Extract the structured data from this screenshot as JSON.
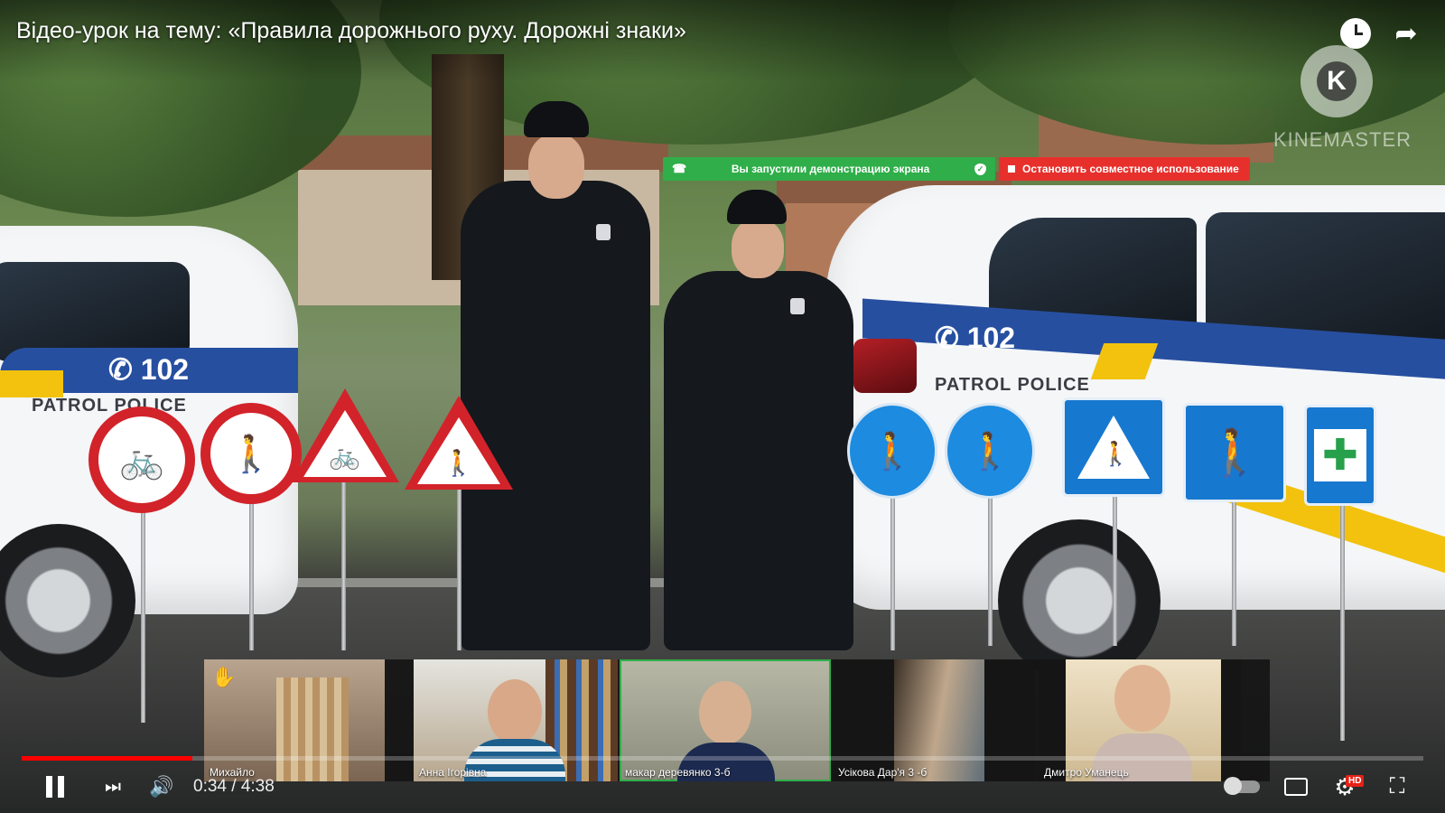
{
  "video": {
    "title": "Відео-урок на тему: «Правила дорожнього руху. Дорожні знаки»",
    "watermark": "KINEMASTER",
    "watermark_letter": "K"
  },
  "top_actions": {
    "watch_later_icon": "clock-icon",
    "share_icon": "share-icon",
    "share_glyph": "➦"
  },
  "screen_share": {
    "status_text": "Вы запустили демонстрацию экрана",
    "stop_text": "Остановить совместное использование",
    "pin_glyph": "☎",
    "shield_glyph": "✓",
    "status_color": "#2fae49",
    "stop_color": "#e7302c"
  },
  "scene": {
    "car_phone": "102",
    "car_text": "PATROL POLICE",
    "signs": [
      {
        "kind": "round-red",
        "glyph": "🚲"
      },
      {
        "kind": "round-red",
        "glyph": "🚶"
      },
      {
        "kind": "tri",
        "glyph": "🚲"
      },
      {
        "kind": "tri",
        "glyph": "🚶"
      },
      {
        "kind": "round-blue",
        "glyph": "🚶"
      },
      {
        "kind": "round-blue",
        "glyph": "🚶"
      },
      {
        "kind": "square-blue",
        "glyph": "🚶"
      },
      {
        "kind": "square-blue",
        "glyph": "🚶"
      },
      {
        "kind": "square-blue",
        "glyph": "✚"
      }
    ]
  },
  "participants": [
    {
      "name": "Михайло",
      "hand_raised": true,
      "active": false
    },
    {
      "name": "Анна Ігорівна",
      "hand_raised": false,
      "active": false
    },
    {
      "name": "макар  деревянко 3-б",
      "hand_raised": false,
      "active": true
    },
    {
      "name": "Усікова Дар'я 3 -б",
      "hand_raised": false,
      "active": false
    },
    {
      "name": "Дмитро Уманець",
      "hand_raised": false,
      "active": false
    }
  ],
  "player": {
    "time_display": "0:34 / 4:38",
    "progress_fraction": 0.122,
    "hd_label": "HD",
    "next_glyph": "⏭",
    "volume_glyph": "🔊",
    "settings_glyph": "⚙",
    "fullscreen_exit_glyph": "⛶",
    "progress_color": "#ff0000"
  }
}
